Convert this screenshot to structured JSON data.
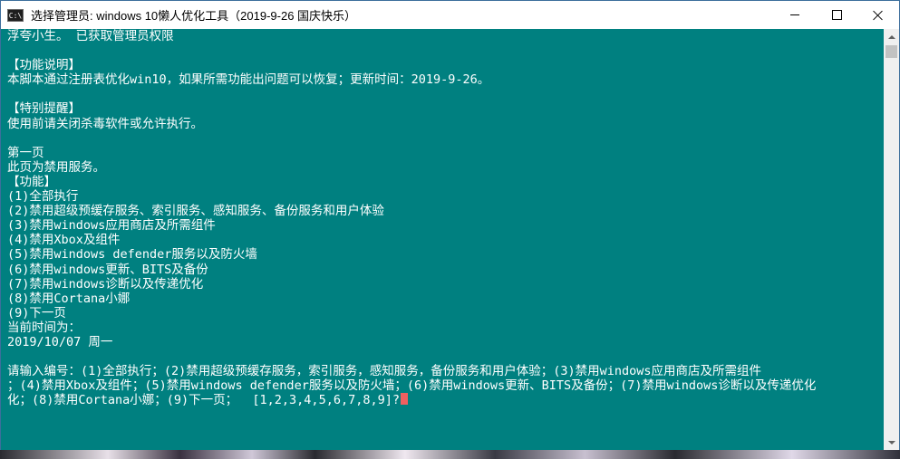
{
  "window": {
    "title": "选择管理员: windows 10懒人优化工具（2019-9-26 国庆快乐）",
    "icon_label": "C:\\"
  },
  "console": {
    "lines": [
      "浮夸小生。 已获取管理员权限",
      "",
      "【功能说明】",
      "本脚本通过注册表优化win10，如果所需功能出问题可以恢复；更新时间：2019-9-26。",
      "",
      "【特别提醒】",
      "使用前请关闭杀毒软件或允许执行。",
      "",
      "第一页",
      "此页为禁用服务。",
      "【功能】",
      "(1)全部执行",
      "(2)禁用超级预缓存服务、索引服务、感知服务、备份服务和用户体验",
      "(3)禁用windows应用商店及所需组件",
      "(4)禁用Xbox及组件",
      "(5)禁用windows defender服务以及防火墙",
      "(6)禁用windows更新、BITS及备份",
      "(7)禁用windows诊断以及传递优化",
      "(8)禁用Cortana小娜",
      "(9)下一页",
      "当前时间为：",
      "2019/10/07 周一",
      "",
      "请输入编号：(1)全部执行；(2)禁用超级预缓存服务，索引服务，感知服务，备份服务和用户体验；(3)禁用windows应用商店及所需组件",
      "；(4)禁用Xbox及组件；(5)禁用windows defender服务以及防火墙；(6)禁用windows更新、BITS及备份；(7)禁用windows诊断以及传递优化",
      "化；(8)禁用Cortana小娜；(9)下一页；  [1,2,3,4,5,6,7,8,9]?"
    ],
    "background_color": "#008080",
    "text_color": "#ffffff",
    "cursor_color": "#f06060"
  },
  "icons": {
    "minimize": "minimize-icon",
    "maximize": "maximize-icon",
    "close": "close-icon",
    "scroll_up": "scroll-up-arrow-icon",
    "scroll_down": "scroll-down-arrow-icon"
  }
}
